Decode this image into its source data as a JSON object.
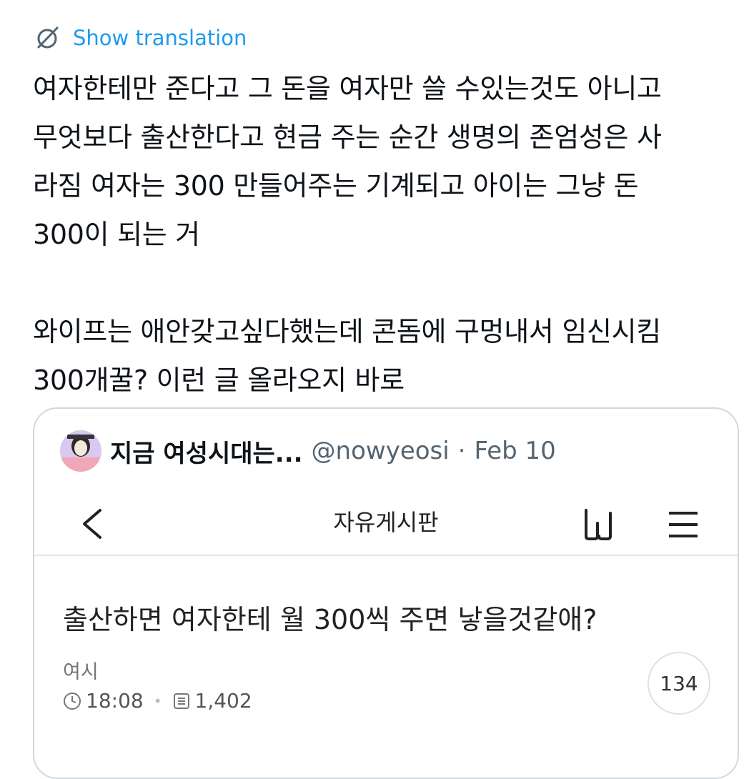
{
  "translation": {
    "label": "Show translation",
    "icon": "translate-globe-icon"
  },
  "tweet": {
    "text": "여자한테만 준다고 그 돈을 여자만 쓸 수있는것도 아니고\n무엇보다 출산한다고 현금 주는 순간 생명의 존엄성은 사\n라짐 여자는 300 만들어주는 기계되고 아이는 그냥 돈\n300이 되는 거\n\n와이프는 애안갖고싶다했는데 콘돔에 구멍내서 임신시킴\n300개꿀? 이런 글 올라오지 바로"
  },
  "quote": {
    "name": "지금 여성시대는...",
    "handle": "@nowyeosi",
    "dot": "·",
    "date": "Feb 10",
    "screenshot": {
      "nav_title": "자유게시판",
      "post_title": "출산하면 여자한테 월 300씩 주면 낳을것같애?",
      "author": "여시",
      "time": "18:08",
      "views": "1,402",
      "comments": "134"
    }
  },
  "colors": {
    "link": "#1d9bf0",
    "border": "#cfd9de",
    "muted": "#536471"
  }
}
